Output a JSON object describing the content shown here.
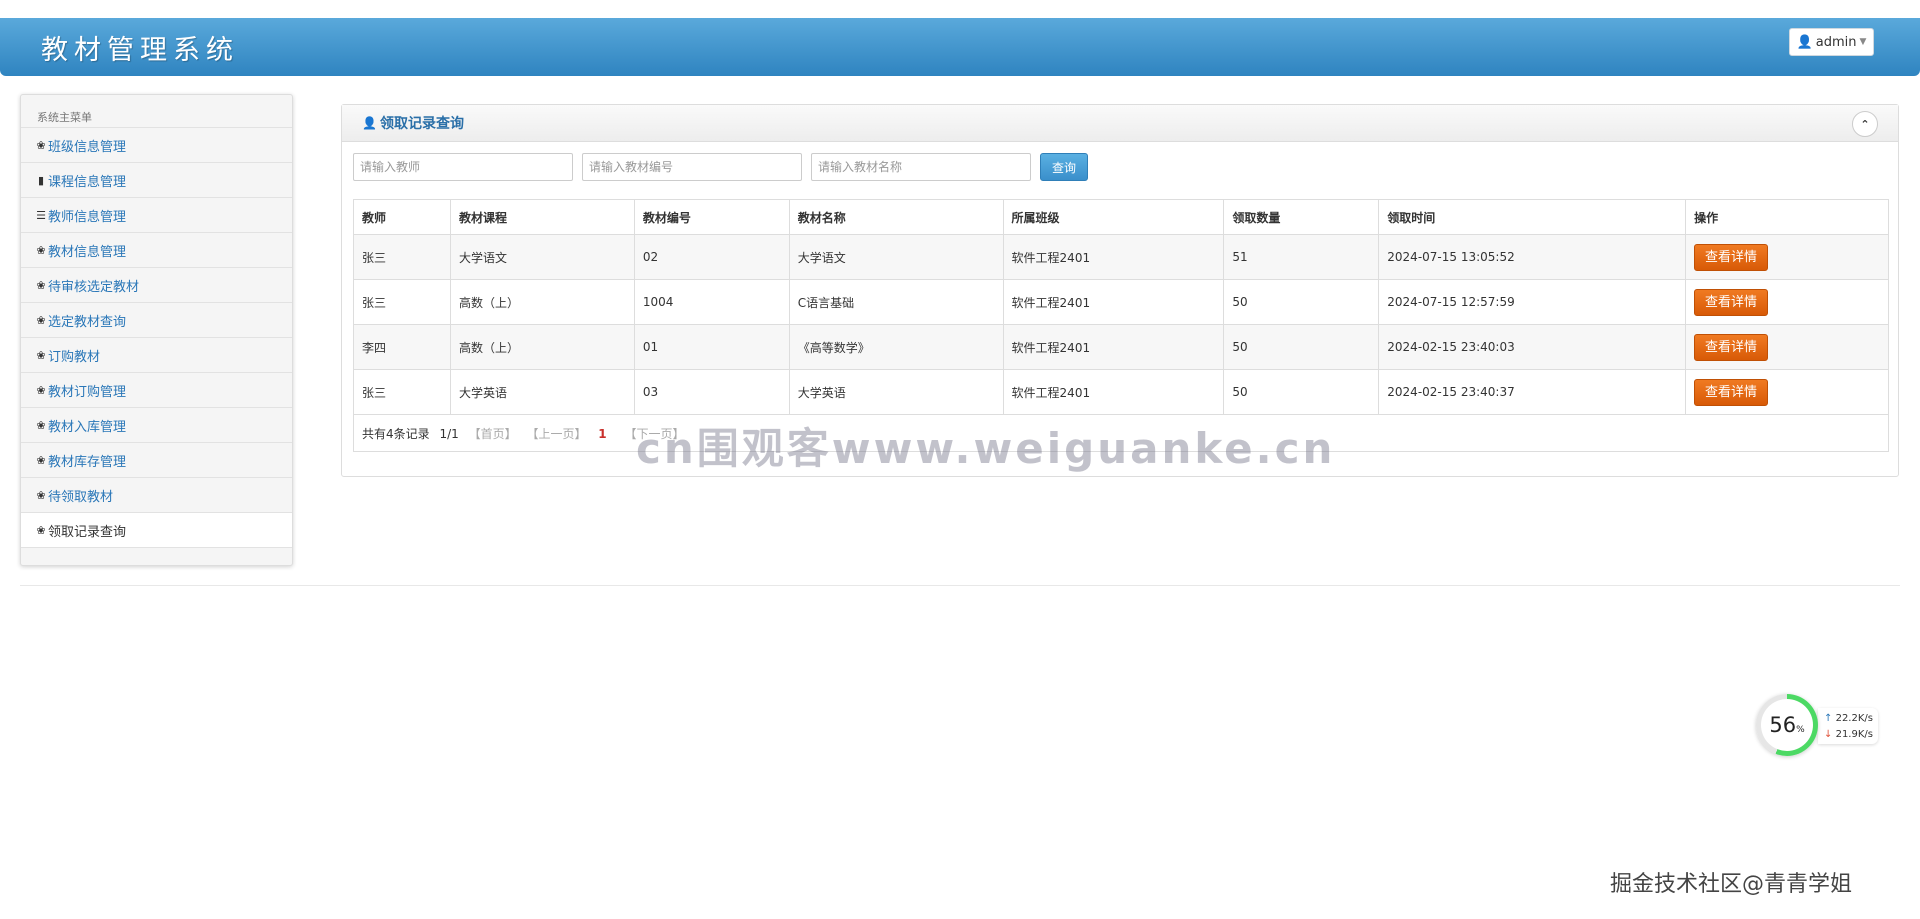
{
  "header": {
    "app_title": "教材管理系统",
    "user_label": "admin"
  },
  "sidebar": {
    "title": "系统主菜单",
    "items": [
      {
        "label": "班级信息管理",
        "icon": "leaf-icon"
      },
      {
        "label": "课程信息管理",
        "icon": "bookmark-icon"
      },
      {
        "label": "教师信息管理",
        "icon": "list-icon"
      },
      {
        "label": "教材信息管理",
        "icon": "leaf-icon"
      },
      {
        "label": "待审核选定教材",
        "icon": "leaf-icon"
      },
      {
        "label": "选定教材查询",
        "icon": "leaf-icon"
      },
      {
        "label": "订购教材",
        "icon": "leaf-icon"
      },
      {
        "label": "教材订购管理",
        "icon": "leaf-icon"
      },
      {
        "label": "教材入库管理",
        "icon": "leaf-icon"
      },
      {
        "label": "教材库存管理",
        "icon": "leaf-icon"
      },
      {
        "label": "待领取教材",
        "icon": "leaf-icon"
      },
      {
        "label": "领取记录查询",
        "icon": "leaf-icon",
        "active": true
      }
    ]
  },
  "panel": {
    "title": "领取记录查询",
    "search": {
      "teacher_placeholder": "请输入教师",
      "code_placeholder": "请输入教材编号",
      "name_placeholder": "请输入教材名称",
      "query_label": "查询"
    },
    "table": {
      "headers": [
        "教师",
        "教材课程",
        "教材编号",
        "教材名称",
        "所属班级",
        "领取数量",
        "领取时间",
        "操作"
      ],
      "rows": [
        {
          "teacher": "张三",
          "course": "大学语文",
          "code": "02",
          "name": "大学语文",
          "class": "软件工程2401",
          "qty": "51",
          "time": "2024-07-15 13:05:52",
          "action": "查看详情"
        },
        {
          "teacher": "张三",
          "course": "高数（上）",
          "code": "1004",
          "name": "C语言基础",
          "class": "软件工程2401",
          "qty": "50",
          "time": "2024-07-15 12:57:59",
          "action": "查看详情"
        },
        {
          "teacher": "李四",
          "course": "高数（上）",
          "code": "01",
          "name": "《高等数学》",
          "class": "软件工程2401",
          "qty": "50",
          "time": "2024-02-15 23:40:03",
          "action": "查看详情"
        },
        {
          "teacher": "张三",
          "course": "大学英语",
          "code": "03",
          "name": "大学英语",
          "class": "软件工程2401",
          "qty": "50",
          "time": "2024-02-15 23:40:37",
          "action": "查看详情"
        }
      ]
    },
    "pager": {
      "summary": "共有4条记录",
      "page_info": "1/1",
      "first": "【首页】",
      "prev": "【上一页】",
      "current": "1",
      "next": "【下一页】"
    }
  },
  "watermark": "cn围观客www.weiguanke.cn",
  "net_monitor": {
    "percent": "56",
    "percent_unit": "%",
    "up": "22.2K/s",
    "down": "21.9K/s"
  },
  "footer_watermark": "掘金技术社区@青青学姐"
}
